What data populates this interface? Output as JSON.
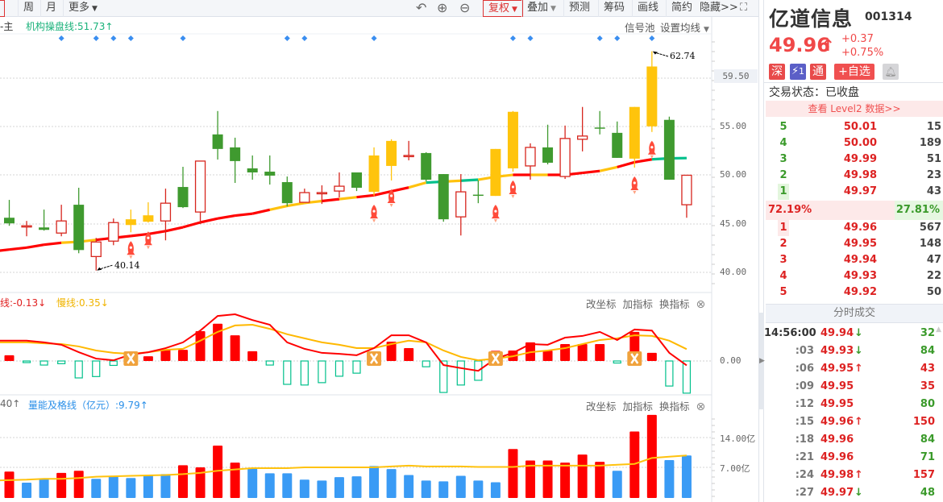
{
  "toolbar": {
    "tabs": [
      "周",
      "月",
      "更多"
    ],
    "buttons": [
      "复权",
      "叠加",
      "预测",
      "筹码",
      "画线",
      "简约",
      "隐藏>>"
    ]
  },
  "main_panel": {
    "left_label": "-主",
    "indicator_label": "机构操盘线:51.73↑",
    "signal_pool": "信号池",
    "ma_settings": "设置均线",
    "axis_labels": [
      "59.50",
      "55.00",
      "50.00",
      "45.00",
      "40.00"
    ],
    "high_label": "62.74",
    "low_label": "40.14"
  },
  "macd_panel": {
    "fast_label": "线:-0.13↓",
    "slow_label": "慢线:0.35↓",
    "zero_label": "0.00",
    "tools": [
      "改坐标",
      "加指标",
      "换指标"
    ]
  },
  "volume_panel": {
    "left_label": "40↑",
    "indicator_label": "量能及格线（亿元）:9.79↑",
    "axis_labels": [
      "14.00亿",
      "7.00亿"
    ],
    "tools": [
      "改坐标",
      "加指标",
      "换指标"
    ]
  },
  "colors": {
    "up": "#d7261e",
    "down": "#3f9a2f",
    "signal": "#ffc40c",
    "teal": "#00c08b",
    "blue": "#3a9bf5",
    "red": "#ff0000"
  },
  "chart_data": {
    "type": "candlestick",
    "candles": [
      [
        45.58,
        47.42,
        44.75,
        45.0,
        "green"
      ],
      [
        44.71,
        45.25,
        43.67,
        44.75,
        "red"
      ],
      [
        44.58,
        46.42,
        44.25,
        44.33,
        "green"
      ],
      [
        44.0,
        46.92,
        43.67,
        45.25,
        "red"
      ],
      [
        46.92,
        48.67,
        41.92,
        42.25,
        "green"
      ],
      [
        41.58,
        43.5,
        40.14,
        43.08,
        "red"
      ],
      [
        43.17,
        45.5,
        42.75,
        45.08,
        "red"
      ],
      [
        44.83,
        46.42,
        44.08,
        45.42,
        "yellow"
      ],
      [
        45.17,
        47.17,
        45.08,
        45.83,
        "yellow"
      ],
      [
        45.25,
        48.58,
        43.25,
        47.08,
        "red"
      ],
      [
        48.75,
        50.83,
        46.58,
        46.67,
        "green"
      ],
      [
        46.17,
        51.42,
        44.92,
        51.42,
        "red"
      ],
      [
        54.17,
        56.58,
        51.58,
        52.67,
        "green"
      ],
      [
        52.83,
        53.83,
        49.17,
        51.42,
        "green"
      ],
      [
        50.67,
        52.0,
        49.5,
        50.25,
        "green"
      ],
      [
        50.33,
        52.0,
        49.0,
        49.92,
        "green"
      ],
      [
        49.25,
        49.83,
        46.75,
        47.08,
        "green"
      ],
      [
        47.17,
        48.58,
        47.17,
        48.17,
        "red"
      ],
      [
        48.13,
        48.92,
        47.0,
        48.17,
        "red"
      ],
      [
        48.33,
        50.25,
        47.67,
        48.83,
        "red"
      ],
      [
        50.25,
        50.25,
        48.33,
        48.67,
        "green"
      ],
      [
        48.25,
        52.83,
        47.83,
        52.0,
        "yellow"
      ],
      [
        50.92,
        53.67,
        49.42,
        53.5,
        "yellow"
      ],
      [
        51.96,
        53.5,
        51.5,
        52.0,
        "red"
      ],
      [
        52.25,
        52.33,
        49.33,
        49.5,
        "green"
      ],
      [
        50.08,
        50.08,
        45.17,
        45.42,
        "green"
      ],
      [
        45.67,
        50.08,
        43.75,
        48.25,
        "red"
      ],
      [
        47.96,
        49.42,
        47.08,
        47.92,
        "green"
      ],
      [
        47.83,
        52.67,
        47.83,
        52.67,
        "yellow"
      ],
      [
        50.67,
        56.58,
        50.33,
        56.5,
        "yellow"
      ],
      [
        50.92,
        53.25,
        49.5,
        52.83,
        "red"
      ],
      [
        52.83,
        55.17,
        51.08,
        51.25,
        "green"
      ],
      [
        49.83,
        55.08,
        49.58,
        53.75,
        "red"
      ],
      [
        53.67,
        57.0,
        52.42,
        54.0,
        "red"
      ],
      [
        54.88,
        56.58,
        54.17,
        54.83,
        "green"
      ],
      [
        54.33,
        55.5,
        51.75,
        51.75,
        "green"
      ],
      [
        51.67,
        57.0,
        50.75,
        57.0,
        "yellow"
      ],
      [
        55.0,
        62.74,
        54.42,
        61.17,
        "yellow"
      ],
      [
        55.67,
        56.0,
        49.5,
        49.5,
        "green"
      ],
      [
        46.92,
        49.96,
        45.58,
        49.96,
        "red"
      ]
    ],
    "institution_line": [
      42.3,
      42.5,
      42.8,
      43.0,
      43.1,
      43.3,
      43.5,
      43.7,
      43.9,
      44.2,
      44.6,
      45.1,
      45.5,
      45.8,
      46.0,
      46.4,
      46.8,
      47.1,
      47.3,
      47.5,
      47.7,
      47.9,
      48.3,
      48.7,
      49.2,
      49.3,
      49.4,
      49.5,
      49.8,
      50.0,
      50.0,
      50.0,
      50.0,
      50.2,
      50.4,
      50.8,
      51.3,
      51.6,
      51.7,
      51.73
    ],
    "institution_line_segments": [
      "r",
      "r",
      "r",
      "y",
      "y",
      "r",
      "r",
      "r",
      "r",
      "r",
      "r",
      "r",
      "r",
      "r",
      "r",
      "y",
      "y",
      "y",
      "r",
      "y",
      "r",
      "r",
      "r",
      "y",
      "t",
      "y",
      "t",
      "y",
      "y",
      "r",
      "y",
      "r",
      "r",
      "r",
      "y",
      "r",
      "r",
      "t",
      "t"
    ],
    "signal_days": [
      3,
      5,
      6,
      7,
      10,
      16,
      17,
      21,
      29,
      30,
      34,
      35,
      37
    ],
    "rocket_days": [
      7,
      8,
      21,
      22,
      28,
      29,
      36,
      37
    ],
    "price_range": [
      38.5,
      64.5
    ],
    "macd": {
      "hist": [
        0.17,
        -0.01,
        -0.12,
        -0.08,
        -0.5,
        -0.46,
        -0.13,
        0.02,
        0.14,
        0.33,
        0.33,
        0.88,
        1.1,
        0.76,
        0.29,
        -0.12,
        -0.69,
        -0.71,
        -0.64,
        -0.45,
        -0.36,
        0.02,
        0.57,
        0.38,
        -0.17,
        -0.93,
        -0.71,
        -0.57,
        0.3,
        0.31,
        0.55,
        0.31,
        0.5,
        0.5,
        0.5,
        -0.06,
        0.86,
        0.24,
        -0.74,
        -0.95
      ],
      "dif": [
        0.6,
        0.6,
        0.55,
        0.48,
        0.26,
        0.07,
        0.02,
        0.19,
        0.26,
        0.38,
        0.55,
        0.9,
        1.33,
        1.38,
        1.21,
        1.07,
        0.55,
        0.36,
        0.24,
        0.21,
        0.17,
        0.38,
        0.76,
        0.76,
        0.55,
        -0.12,
        -0.21,
        -0.29,
        0.07,
        0.24,
        0.5,
        0.48,
        0.69,
        0.74,
        0.86,
        0.62,
        0.93,
        0.9,
        0.24,
        -0.13
      ],
      "dea": [
        0.55,
        0.55,
        0.52,
        0.5,
        0.43,
        0.31,
        0.24,
        0.21,
        0.26,
        0.33,
        0.36,
        0.6,
        0.86,
        1.05,
        1.07,
        0.95,
        0.79,
        0.67,
        0.55,
        0.48,
        0.38,
        0.38,
        0.5,
        0.6,
        0.55,
        0.31,
        0.12,
        0.02,
        0.07,
        0.14,
        0.26,
        0.31,
        0.38,
        0.5,
        0.62,
        0.67,
        0.76,
        0.74,
        0.6,
        0.35
      ],
      "cross_days": [
        7,
        21,
        28,
        36
      ]
    },
    "volume": {
      "values": [
        6.0,
        3.4,
        4.3,
        5.7,
        6.2,
        4.3,
        4.8,
        4.5,
        5.2,
        5.4,
        7.5,
        7.0,
        12.1,
        8.1,
        6.7,
        5.6,
        5.6,
        4.1,
        3.9,
        4.7,
        4.9,
        7.3,
        6.6,
        5.2,
        3.9,
        3.7,
        5.0,
        3.9,
        3.5,
        11.3,
        8.6,
        8.6,
        8.1,
        10.0,
        8.3,
        6.2,
        15.4,
        19.3,
        8.7,
        9.79
      ],
      "colors": [
        "r",
        "b",
        "b",
        "r",
        "r",
        "b",
        "b",
        "b",
        "b",
        "b",
        "r",
        "r",
        "r",
        "r",
        "b",
        "b",
        "b",
        "b",
        "b",
        "b",
        "b",
        "b",
        "b",
        "b",
        "b",
        "b",
        "b",
        "b",
        "b",
        "r",
        "r",
        "r",
        "r",
        "r",
        "r",
        "b",
        "r",
        "r",
        "b",
        "b"
      ],
      "pass_line": [
        4.0,
        4.1,
        4.3,
        4.3,
        4.5,
        4.8,
        4.9,
        5.0,
        5.1,
        5.2,
        5.4,
        5.7,
        6.2,
        6.5,
        6.8,
        6.8,
        6.8,
        7.0,
        7.0,
        7.0,
        7.0,
        7.0,
        7.2,
        7.4,
        7.2,
        7.2,
        7.2,
        7.1,
        7.1,
        7.1,
        7.4,
        7.4,
        7.4,
        7.4,
        7.4,
        7.6,
        7.8,
        9.2,
        9.5,
        9.79
      ],
      "unit": "亿元"
    }
  },
  "quote": {
    "name": "亿道信息",
    "code": "001314",
    "price": "49.96",
    "arrow": "↑",
    "change": "+0.37",
    "change_pct": "+0.75%",
    "badges": [
      "深",
      "1",
      "通",
      "+自选"
    ],
    "status": "交易状态：已收盘",
    "level2": "查看 Level2 数据>>",
    "asks": [
      {
        "level": "5",
        "price": "50.01",
        "vol": "15"
      },
      {
        "level": "4",
        "price": "50.00",
        "vol": "189"
      },
      {
        "level": "3",
        "price": "49.99",
        "vol": "51"
      },
      {
        "level": "2",
        "price": "49.98",
        "vol": "23"
      },
      {
        "level": "1",
        "price": "49.97",
        "vol": "43"
      }
    ],
    "buy_ratio": "72.19%",
    "sell_ratio": "27.81%",
    "bids": [
      {
        "level": "1",
        "price": "49.96",
        "vol": "567"
      },
      {
        "level": "2",
        "price": "49.95",
        "vol": "148"
      },
      {
        "level": "3",
        "price": "49.94",
        "vol": "47"
      },
      {
        "level": "4",
        "price": "49.93",
        "vol": "22"
      },
      {
        "level": "5",
        "price": "49.92",
        "vol": "50"
      }
    ],
    "trades_title": "分时成交",
    "trades": [
      {
        "time": "14:56:00",
        "price": "49.94",
        "dir": "↓",
        "vol": "32",
        "vc": "g"
      },
      {
        "time": ":03",
        "price": "49.93",
        "dir": "↓",
        "vol": "84",
        "vc": "g"
      },
      {
        "time": ":06",
        "price": "49.95",
        "dir": "↑",
        "vol": "43",
        "vc": "r"
      },
      {
        "time": ":09",
        "price": "49.95",
        "dir": "",
        "vol": "35",
        "vc": "r"
      },
      {
        "time": ":12",
        "price": "49.95",
        "dir": "",
        "vol": "80",
        "vc": "g"
      },
      {
        "time": ":15",
        "price": "49.96",
        "dir": "↑",
        "vol": "150",
        "vc": "r"
      },
      {
        "time": ":18",
        "price": "49.96",
        "dir": "",
        "vol": "84",
        "vc": "g"
      },
      {
        "time": ":21",
        "price": "49.96",
        "dir": "",
        "vol": "71",
        "vc": "g"
      },
      {
        "time": ":24",
        "price": "49.98",
        "dir": "↑",
        "vol": "157",
        "vc": "r"
      },
      {
        "time": ":27",
        "price": "49.97",
        "dir": "↓",
        "vol": "48",
        "vc": "g"
      }
    ]
  }
}
